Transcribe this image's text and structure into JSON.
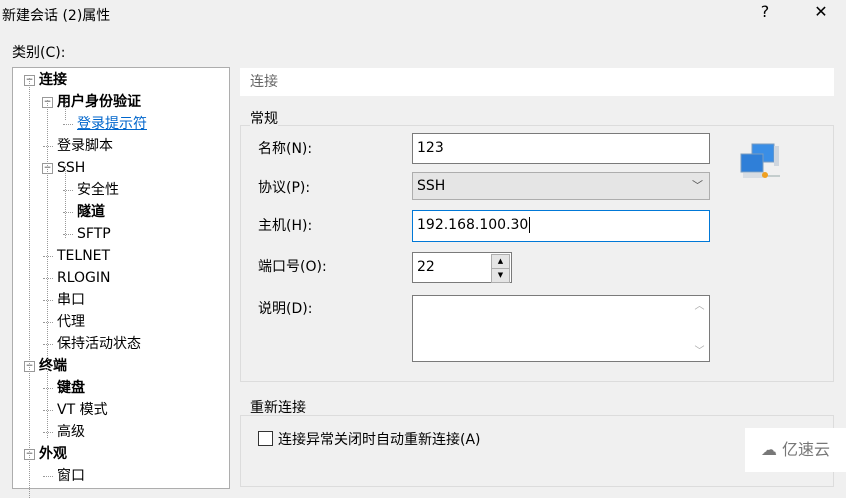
{
  "window": {
    "title": "新建会话 (2)属性",
    "help": "?",
    "close": "✕"
  },
  "category_label": "类别(C):",
  "tree": [
    {
      "label": "连接",
      "level": 0,
      "bold": true,
      "expander": true
    },
    {
      "label": "用户身份验证",
      "level": 1,
      "bold": true,
      "expander": true
    },
    {
      "label": "登录提示符",
      "level": 2,
      "link": true
    },
    {
      "label": "登录脚本",
      "level": 1
    },
    {
      "label": "SSH",
      "level": 1,
      "expander": true
    },
    {
      "label": "安全性",
      "level": 2
    },
    {
      "label": "隧道",
      "level": 2,
      "bold": true
    },
    {
      "label": "SFTP",
      "level": 2
    },
    {
      "label": "TELNET",
      "level": 1
    },
    {
      "label": "RLOGIN",
      "level": 1
    },
    {
      "label": "串口",
      "level": 1
    },
    {
      "label": "代理",
      "level": 1
    },
    {
      "label": "保持活动状态",
      "level": 1
    },
    {
      "label": "终端",
      "level": 0,
      "bold": true,
      "expander": true
    },
    {
      "label": "键盘",
      "level": 1,
      "bold": true
    },
    {
      "label": "VT 模式",
      "level": 1
    },
    {
      "label": "高级",
      "level": 1
    },
    {
      "label": "外观",
      "level": 0,
      "bold": true,
      "expander": true
    },
    {
      "label": "窗口",
      "level": 1
    }
  ],
  "panel": {
    "header": "连接",
    "general": {
      "title": "常规",
      "name_label": "名称(N):",
      "name": "123",
      "protocol_label": "协议(P):",
      "protocol": "SSH",
      "host_label": "主机(H):",
      "host": "192.168.100.30",
      "port_label": "端口号(O):",
      "port": "22",
      "desc_label": "说明(D):",
      "desc": ""
    },
    "reconnect": {
      "title": "重新连接",
      "checkbox": "连接异常关闭时自动重新连接(A)",
      "checked": false
    }
  },
  "watermark": "亿速云"
}
